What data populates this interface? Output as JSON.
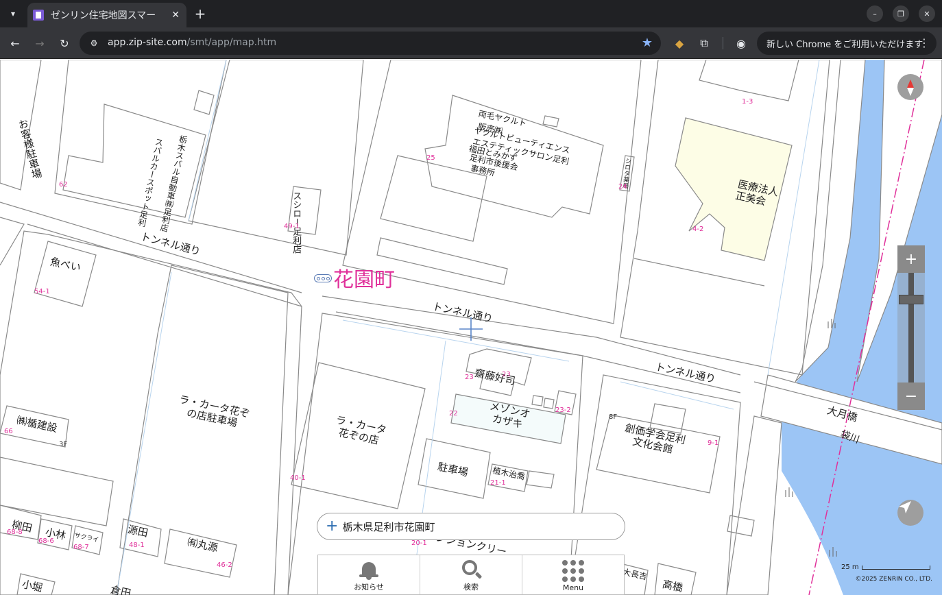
{
  "browser": {
    "tab_title": "ゼンリン住宅地図スマー",
    "url_host": "app.zip-site.com",
    "url_path": "/smt/app/map.htm",
    "update_text": "新しい Chrome をご利用いただけます"
  },
  "map": {
    "town_name": "花園町",
    "roads": {
      "tunnel_1": "トンネル通り",
      "tunnel_2": "トンネル通り",
      "tunnel_3": "トンネル通り",
      "bridge": "大月橋",
      "river": "袋川"
    },
    "labels": {
      "okyakusama": "お客様駐車場",
      "subaru_1": "栃木スバル自動車㈱足利店",
      "subaru_2": "スバルカースポット足利",
      "sushiro": "スシロー足利店",
      "yakult_1": "両毛ヤクルト",
      "yakult_2": "販売㈱",
      "yakult_3": "ヤクルトビューティエンス",
      "yakult_4": "エステティックサロン足利",
      "yakult_5": "福田とみかず",
      "yakult_6": "足利市後援会",
      "yakult_7": "事務所",
      "shiroda": "シロタ薬局",
      "iryou": "医療法人正美会",
      "uobei": "魚べい",
      "lacarta_parking": "ラ・カータ花ぞの店駐車場",
      "lacarta": "ラ・カータ花ぞの店",
      "kanto": "㈱楯建設",
      "saitou": "齋藤好司",
      "maison": "メゾンオカザキ",
      "parking": "駐車場",
      "ueki": "植木治喬",
      "soka": "創価学会足利文化会館",
      "yanagida": "柳田",
      "kobayashi": "小林",
      "sakurai": "サクライ",
      "minamoto": "源田",
      "marugen": "㈲丸源",
      "mansion": "マンションクリー",
      "kohori": "小堀",
      "takahashi": "高橋",
      "tsukamoto": "大長吉",
      "kura": "倉田"
    },
    "numbers": {
      "n62": "62",
      "n49_1": "49-1",
      "n25": "25",
      "n24": "24",
      "n1_3": "1-3",
      "n4_2": "4-2",
      "n54_1": "54-1",
      "n66": "66",
      "n3f": "3F",
      "n40_1": "40-1",
      "n23": "23",
      "n23b": "23",
      "n22": "22",
      "n23_2": "23-2",
      "n21_1": "21-1",
      "n9_1": "9-1",
      "n8f": "8F",
      "n68_8": "68-8",
      "n68_6": "68-6",
      "n68_7": "68-7",
      "n48_1": "48-1",
      "n46_2": "46-2",
      "n20_1": "20-1"
    },
    "scale_label": "25 m",
    "copyright": "©2025 ZENRIN CO., LTD.",
    "zoom_level_fraction": 0.22
  },
  "search": {
    "address": "栃木県足利市花園町"
  },
  "bottom_menu": {
    "notice": "お知らせ",
    "search": "検索",
    "menu": "Menu"
  },
  "colors": {
    "town_magenta": "#e0309a",
    "river_blue": "#9cc5f5",
    "highlight_yellow": "#fdfde6",
    "building_line": "#888888"
  }
}
